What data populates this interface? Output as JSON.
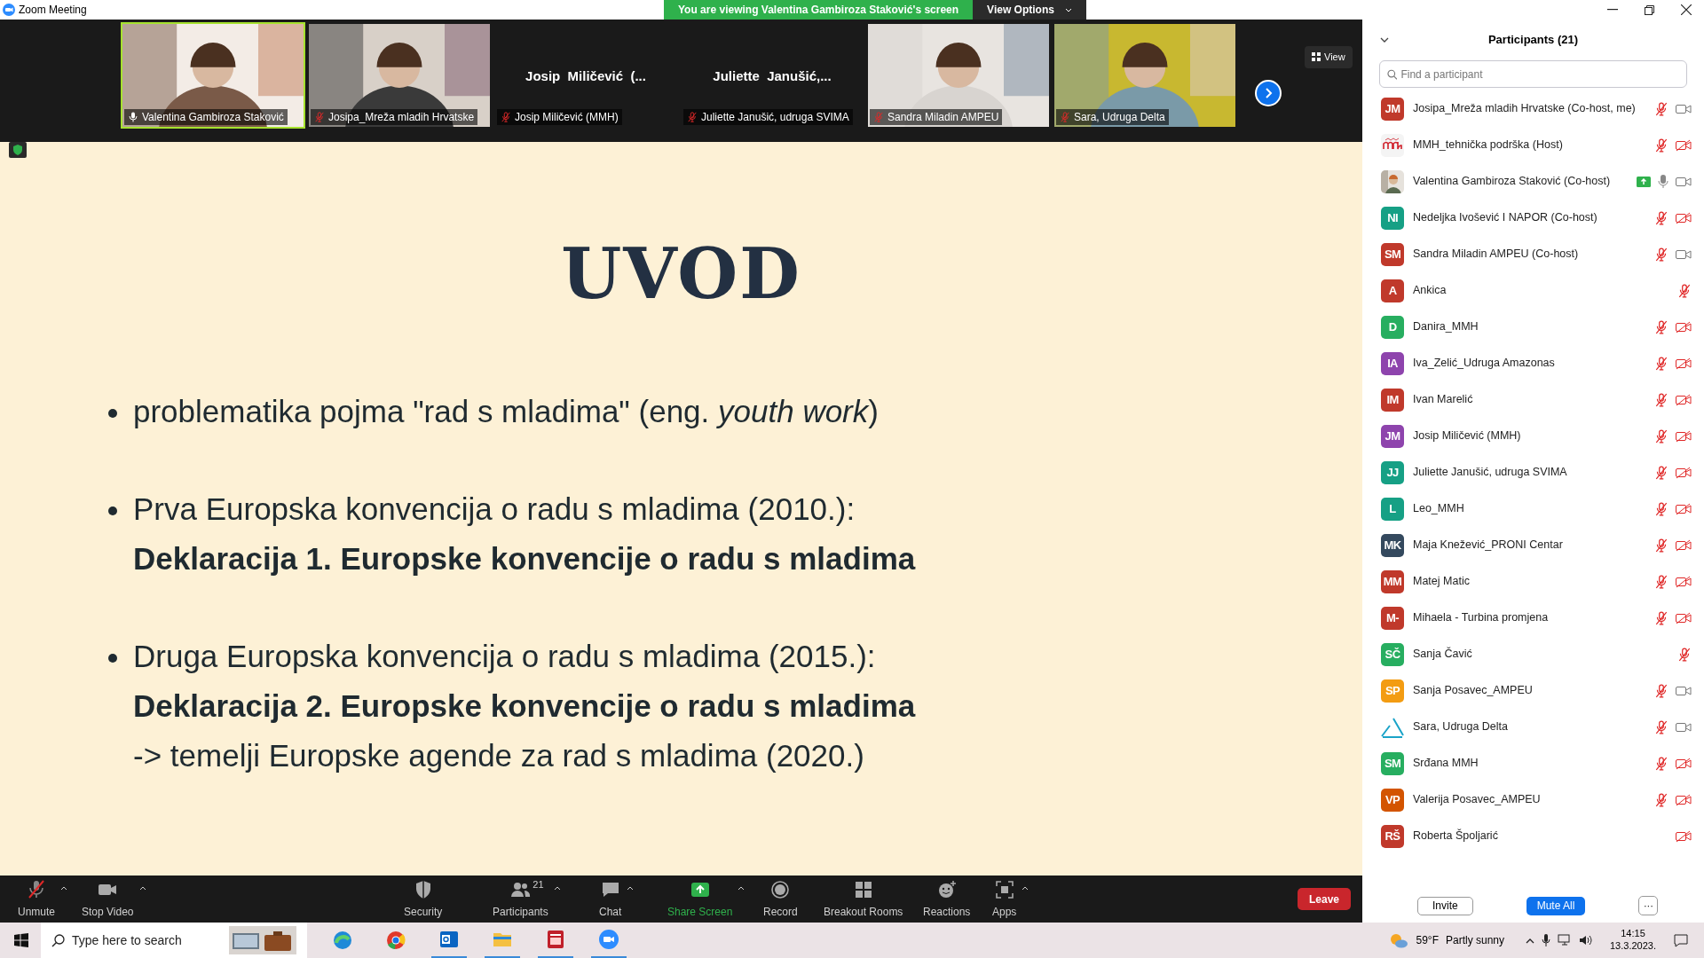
{
  "window": {
    "title": "Zoom Meeting"
  },
  "share_banner": {
    "text": "You are viewing Valentina Gambiroza Staković's screen",
    "button": "View Options"
  },
  "video_strip": {
    "view_button": "View",
    "tiles": [
      {
        "kind": "video",
        "name": "Valentina Gambiroza Staković",
        "muted": false,
        "selected": true
      },
      {
        "kind": "video",
        "name": "Josipa_Mreža mladih Hrvatske",
        "muted": true,
        "selected": false
      },
      {
        "kind": "name",
        "header": "Josip  Miličević  (...",
        "name": "Josip Miličević (MMH)",
        "muted": true,
        "selected": false
      },
      {
        "kind": "name",
        "header": "Juliette  Janušić,...",
        "name": "Juliette Janušić, udruga SVIMA",
        "muted": true,
        "selected": false
      },
      {
        "kind": "video",
        "name": "Sandra Miladin AMPEU",
        "muted": true,
        "selected": false
      },
      {
        "kind": "video",
        "name": "Sara, Udruga Delta",
        "muted": true,
        "selected": false
      }
    ]
  },
  "slide": {
    "title": "UVOD",
    "bullets": [
      {
        "lines": [
          {
            "kind": "normal",
            "text": "problematika pojma \"rad s mladima\" (eng. *youth work*)"
          }
        ]
      },
      {
        "lines": [
          {
            "kind": "normal",
            "text": "Prva Europska konvencija o radu s mladima (2010.):"
          },
          {
            "kind": "bold",
            "text": "Deklaracija 1. Europske konvencije o radu s mladima"
          }
        ]
      },
      {
        "lines": [
          {
            "kind": "normal",
            "text": "Druga Europska konvencija o radu s mladima (2015.):"
          },
          {
            "kind": "bold",
            "text": "Deklaracija 2. Europske konvencije o radu s mladima"
          },
          {
            "kind": "normal",
            "text": "-> temelji Europske agende za rad s mladima (2020.)"
          }
        ]
      }
    ]
  },
  "toolbar": {
    "items": [
      {
        "kind": "mic-muted",
        "label": "Unmute",
        "caret": true
      },
      {
        "kind": "video",
        "label": "Stop Video",
        "caret": true
      },
      {
        "kind": "shield",
        "label": "Security",
        "caret": false
      },
      {
        "kind": "people",
        "label": "Participants",
        "badge": "21",
        "caret": true
      },
      {
        "kind": "chat",
        "label": "Chat",
        "caret": true
      },
      {
        "kind": "share",
        "label": "Share Screen",
        "caret": true
      },
      {
        "kind": "record",
        "label": "Record",
        "caret": false
      },
      {
        "kind": "grid",
        "label": "Breakout Rooms",
        "caret": false
      },
      {
        "kind": "smiley",
        "label": "Reactions",
        "caret": false
      },
      {
        "kind": "apps",
        "label": "Apps",
        "caret": true
      }
    ],
    "leave": "Leave"
  },
  "participants_panel": {
    "title": "Participants (21)",
    "search": {
      "placeholder": "Find a participant"
    },
    "participants": [
      {
        "kind": "initials",
        "initials": "JM",
        "color": "#c0392b",
        "name": "Josipa_Mreža mladih Hrvatske (Co-host, me)",
        "sharing": false,
        "mic_muted": true,
        "video_off": false
      },
      {
        "kind": "logo",
        "name": "MMH_tehnička podrška (Host)",
        "sharing": false,
        "mic_muted": true,
        "video_off": true
      },
      {
        "name": "Valentina Gambiroza Staković (Co-host)",
        "sharing": true,
        "mic_muted": false,
        "video_off": false
      },
      {
        "kind": "initials",
        "initials": "NI",
        "color": "#16a085",
        "name": "Nedeljka Ivošević I NAPOR (Co-host)",
        "sharing": false,
        "mic_muted": true,
        "video_off": true
      },
      {
        "kind": "initials",
        "initials": "SM",
        "color": "#c0392b",
        "name": "Sandra Miladin AMPEU (Co-host)",
        "sharing": false,
        "mic_muted": true,
        "video_off": false
      },
      {
        "kind": "initials",
        "initials": "A",
        "color": "#c0392b",
        "name": "Ankica",
        "sharing": false,
        "mic_muted": true
      },
      {
        "kind": "initials",
        "initials": "D",
        "color": "#27ae60",
        "name": "Danira_MMH",
        "sharing": false,
        "mic_muted": true,
        "video_off": true
      },
      {
        "kind": "initials",
        "initials": "IA",
        "color": "#8e44ad",
        "name": "Iva_Zelić_Udruga Amazonas",
        "sharing": false,
        "mic_muted": true,
        "video_off": true
      },
      {
        "kind": "initials",
        "initials": "IM",
        "color": "#c0392b",
        "name": "Ivan Marelić",
        "sharing": false,
        "mic_muted": true,
        "video_off": true
      },
      {
        "kind": "initials",
        "initials": "JM",
        "color": "#8e44ad",
        "name": "Josip Miličević (MMH)",
        "sharing": false,
        "mic_muted": true,
        "video_off": true
      },
      {
        "kind": "initials",
        "initials": "JJ",
        "color": "#16a085",
        "name": "Juliette Janušić, udruga SVIMA",
        "sharing": false,
        "mic_muted": true,
        "video_off": true
      },
      {
        "kind": "initials",
        "initials": "L",
        "color": "#16a085",
        "name": "Leo_MMH",
        "sharing": false,
        "mic_muted": true,
        "video_off": true
      },
      {
        "kind": "initials",
        "initials": "MK",
        "color": "#34495e",
        "name": "Maja Knežević_PRONI Centar",
        "sharing": false,
        "mic_muted": true,
        "video_off": true
      },
      {
        "kind": "initials",
        "initials": "MM",
        "color": "#c0392b",
        "name": "Matej Matic",
        "sharing": false,
        "mic_muted": true,
        "video_off": true
      },
      {
        "kind": "initials",
        "initials": "M-",
        "color": "#c0392b",
        "name": "Mihaela - Turbina promjena",
        "sharing": false,
        "mic_muted": true,
        "video_off": true
      },
      {
        "kind": "initials",
        "initials": "SČ",
        "color": "#27ae60",
        "name": "Sanja Čavić",
        "sharing": false,
        "mic_muted": true
      },
      {
        "kind": "initials",
        "initials": "SP",
        "color": "#f39c12",
        "name": "Sanja Posavec_AMPEU",
        "sharing": false,
        "mic_muted": true,
        "video_off": false
      },
      {
        "kind": "triangle",
        "name": "Sara, Udruga Delta",
        "sharing": false,
        "mic_muted": true,
        "video_off": false
      },
      {
        "kind": "initials",
        "initials": "SM",
        "color": "#27ae60",
        "name": "Srđana MMH",
        "sharing": false,
        "mic_muted": true,
        "video_off": true
      },
      {
        "kind": "initials",
        "initials": "VP",
        "color": "#d35400",
        "name": "Valerija Posavec_AMPEU",
        "sharing": false,
        "mic_muted": true,
        "video_off": true
      },
      {
        "kind": "initials",
        "initials": "RŠ",
        "color": "#c0392b",
        "name": "Roberta Špoljarić",
        "sharing": false,
        "video_off": true
      }
    ],
    "buttons": {
      "invite": "Invite",
      "mute_all": "Mute All",
      "more": "···"
    }
  },
  "taskbar": {
    "search_placeholder": "Type here to search",
    "temperature": "59°F",
    "weather": "Partly sunny",
    "time": "14:15",
    "date": "13.3.2023."
  }
}
